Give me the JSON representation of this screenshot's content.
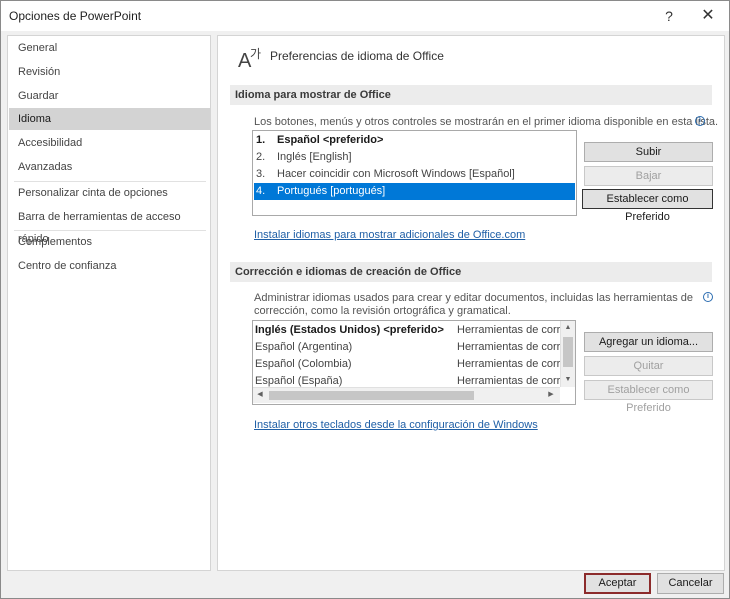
{
  "window": {
    "title": "Opciones de PowerPoint",
    "help": "?",
    "close": "✕"
  },
  "nav": {
    "items": [
      {
        "label": "General"
      },
      {
        "label": "Revisión"
      },
      {
        "label": "Guardar"
      },
      {
        "label": "Idioma",
        "selected": true
      },
      {
        "label": "Accesibilidad"
      },
      {
        "label": "Avanzadas"
      },
      {
        "label": "Personalizar cinta de opciones"
      },
      {
        "label": "Barra de herramientas de acceso rápido"
      },
      {
        "label": "Complementos"
      },
      {
        "label": "Centro de confianza"
      }
    ]
  },
  "header": {
    "title": "Preferencias de idioma de Office",
    "icon": "language-icon"
  },
  "display": {
    "section_title": "Idioma para mostrar de Office",
    "description": "Los botones, menús y otros controles se mostrarán en el primer idioma disponible en esta lista.",
    "languages": [
      {
        "num": "1.",
        "label": "Español <preferido>"
      },
      {
        "num": "2.",
        "label": "Inglés [English]"
      },
      {
        "num": "3.",
        "label": "Hacer coincidir con Microsoft Windows [Español]"
      },
      {
        "num": "4.",
        "label": "Portugués [portugués]"
      }
    ],
    "selected_index": 3,
    "btn_up": "Subir",
    "btn_down": "Bajar",
    "btn_preferred": "Establecer como Preferido",
    "link": "Instalar idiomas para mostrar adicionales de Office.com"
  },
  "authoring": {
    "section_title": "Corrección e idiomas de creación de Office",
    "description_line1": "Administrar idiomas usados para crear y editar documentos, incluidas las herramientas de",
    "description_line2": "corrección, como la revisión ortográfica y gramatical.",
    "languages": [
      {
        "label": "Inglés (Estados Unidos) <preferido>",
        "tools": "Herramientas de corre"
      },
      {
        "label": "Español (Argentina)",
        "tools": "Herramientas de corre"
      },
      {
        "label": "Español (Colombia)",
        "tools": "Herramientas de corre"
      },
      {
        "label": "Español (España)",
        "tools": "Herramientas de corre"
      }
    ],
    "btn_add": "Agregar un idioma...",
    "btn_remove": "Quitar",
    "btn_preferred": "Establecer como Preferido",
    "link": "Instalar otros teclados desde la configuración de Windows"
  },
  "footer": {
    "ok": "Aceptar",
    "cancel": "Cancelar"
  }
}
